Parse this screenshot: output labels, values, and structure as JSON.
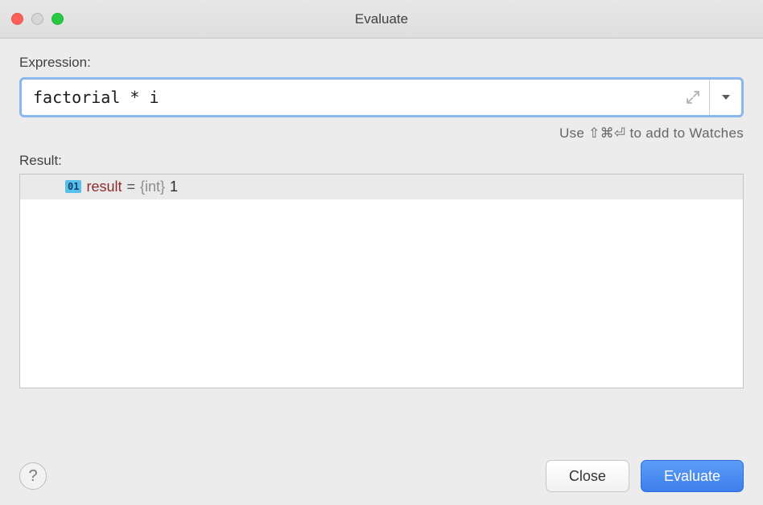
{
  "window": {
    "title": "Evaluate"
  },
  "labels": {
    "expression": "Expression:",
    "result": "Result:",
    "hint": "Use ⇧⌘⏎ to add to Watches"
  },
  "expression": {
    "value": "factorial * i"
  },
  "result": {
    "rows": [
      {
        "badge": "01",
        "name": "result",
        "equals": "=",
        "type": "{int}",
        "value": "1"
      }
    ]
  },
  "buttons": {
    "help": "?",
    "close": "Close",
    "evaluate": "Evaluate"
  }
}
